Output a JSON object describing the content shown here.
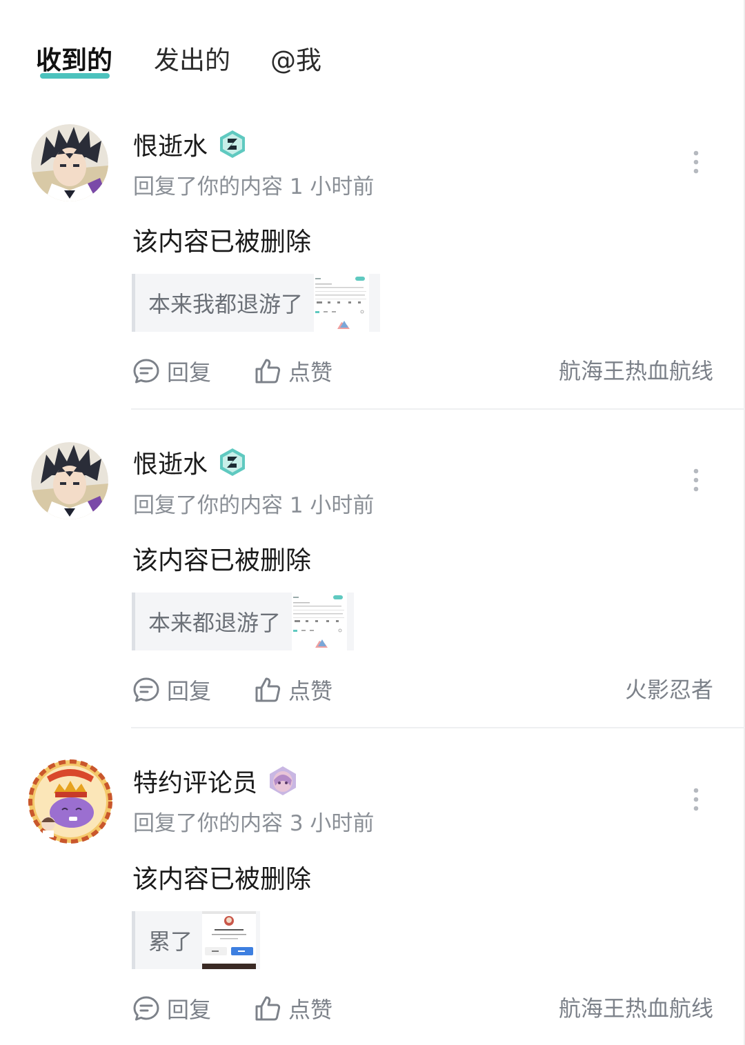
{
  "tabs": [
    {
      "label": "收到的",
      "active": true
    },
    {
      "label": "发出的",
      "active": false
    },
    {
      "label": "@我",
      "active": false
    }
  ],
  "colors": {
    "accent": "#4cc2bd",
    "meta_text": "#8a8f96",
    "action_text": "#7c8189"
  },
  "notifications": [
    {
      "user": "恨逝水",
      "action_time": "回复了你的内容 1 小时前",
      "content": "该内容已被删除",
      "quote": "本来我都退游了",
      "reply_label": "回复",
      "like_label": "点赞",
      "game": "航海王热血航线",
      "avatar_icon": "anime-boy-avatar",
      "badge_icon": "teal-hexagon-badge-icon"
    },
    {
      "user": "恨逝水",
      "action_time": "回复了你的内容 1 小时前",
      "content": "该内容已被删除",
      "quote": "本来都退游了",
      "reply_label": "回复",
      "like_label": "点赞",
      "game": "火影忍者",
      "avatar_icon": "anime-boy-avatar",
      "badge_icon": "teal-hexagon-badge-icon"
    },
    {
      "user": "特约评论员",
      "action_time": "回复了你的内容 3 小时前",
      "content": "该内容已被删除",
      "quote": "累了",
      "reply_label": "回复",
      "like_label": "点赞",
      "game": "航海王热血航线",
      "avatar_icon": "purple-mascot-crown-avatar",
      "badge_icon": "purple-character-badge-icon"
    }
  ]
}
